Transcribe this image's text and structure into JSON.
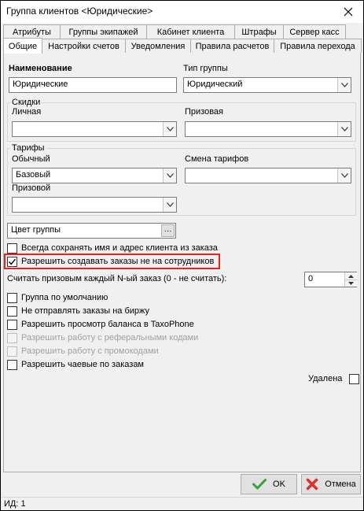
{
  "window": {
    "title": "Группа клиентов <Юридические>"
  },
  "tabs_row1": [
    "Атрибуты",
    "Группы экипажей",
    "Кабинет клиента",
    "Штрафы",
    "Сервер касс"
  ],
  "tabs_row2": [
    "Общие",
    "Настройки счетов",
    "Уведомления",
    "Правила расчетов",
    "Правила перехода"
  ],
  "active_tab": "Общие",
  "name": {
    "label": "Наименование",
    "value": "Юридические"
  },
  "group_type": {
    "label": "Тип группы",
    "value": "Юридический"
  },
  "discounts": {
    "title": "Скидки",
    "personal_label": "Личная",
    "personal_value": "",
    "prize_label": "Призовая",
    "prize_value": ""
  },
  "tariffs": {
    "title": "Тарифы",
    "regular_label": "Обычный",
    "regular_value": "Базовый",
    "change_label": "Смена тарифов",
    "change_value": "",
    "prize_label": "Призовой",
    "prize_value": ""
  },
  "color": {
    "value": "Цвет группы",
    "button_label": "···"
  },
  "options": {
    "save_name_address": {
      "label": "Всегда сохранять имя и адрес клиента из заказа",
      "checked": false
    },
    "allow_non_employee_orders": {
      "label": "Разрешить создавать заказы не на сотрудников",
      "checked": true
    },
    "prize_nth": {
      "label": "Считать призовым каждый N-ый заказ (0 - не считать):",
      "value": "0"
    },
    "default_group": {
      "label": "Группа по умолчанию",
      "checked": false
    },
    "no_exchange": {
      "label": "Не отправлять заказы на биржу",
      "checked": false
    },
    "taxophone_balance": {
      "label": "Разрешить просмотр баланса в TaxoPhone",
      "checked": false
    },
    "referral_codes": {
      "label": "Разрешить работу с реферальными кодами",
      "checked": false,
      "disabled": true
    },
    "promo_codes": {
      "label": "Разрешить работу с промокодами",
      "checked": false,
      "disabled": true
    },
    "tips": {
      "label": "Разрешить чаевые по заказам",
      "checked": false
    },
    "deleted": {
      "label": "Удалена",
      "checked": false
    }
  },
  "buttons": {
    "ok": "OK",
    "cancel": "Отмена"
  },
  "status": {
    "id": "ИД: 1"
  },
  "colors": {
    "highlight": "#e8231b",
    "ok_green": "#3aa13a",
    "cancel_red": "#d9342b"
  }
}
